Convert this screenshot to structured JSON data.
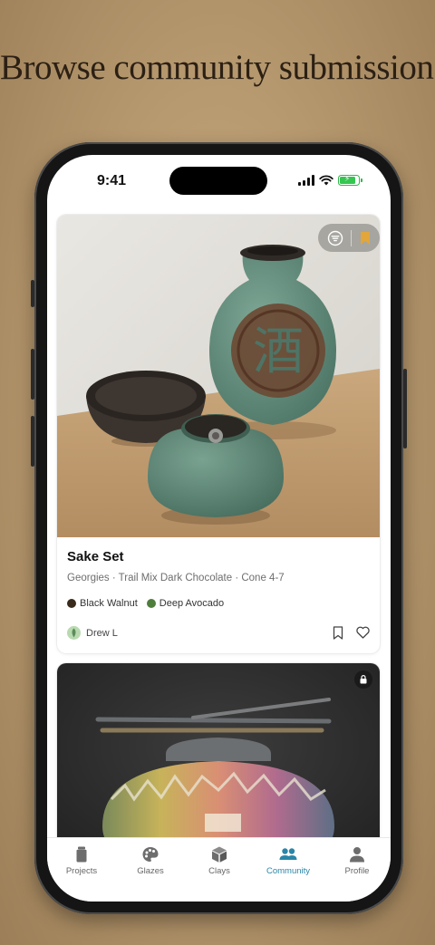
{
  "headline": "Browse community submissions",
  "status_bar": {
    "time": "9:41"
  },
  "cards": [
    {
      "title": "Sake Set",
      "subtitle": "Georgies · Trail Mix Dark Chocolate · Cone 4-7",
      "glazes": [
        {
          "name": "Black Walnut",
          "color": "#3a2a1c"
        },
        {
          "name": "Deep Avocado",
          "color": "#4f7d3b"
        }
      ],
      "author": "Drew L"
    }
  ],
  "tabs": [
    {
      "label": "Projects",
      "icon": "jar-icon"
    },
    {
      "label": "Glazes",
      "icon": "palette-icon"
    },
    {
      "label": "Clays",
      "icon": "cube-icon"
    },
    {
      "label": "Community",
      "icon": "people-icon",
      "active": true
    },
    {
      "label": "Profile",
      "icon": "person-icon"
    }
  ],
  "colors": {
    "accent": "#2a86a8",
    "bookmark": "#e2a63a",
    "background": "#b89a70"
  }
}
